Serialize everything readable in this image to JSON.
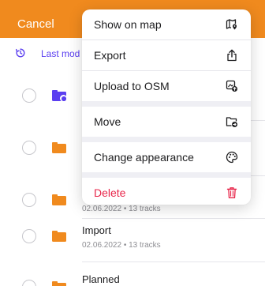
{
  "header": {
    "cancel_label": "Cancel",
    "color": "#f08a1e"
  },
  "sort": {
    "label": "Last mod"
  },
  "list": {
    "items": [
      {
        "title": "",
        "subtitle": "",
        "icon": "folder-settings-icon"
      },
      {
        "title": "",
        "subtitle": "",
        "icon": "folder-icon"
      },
      {
        "title": "",
        "subtitle": "02.06.2022 • 13 tracks",
        "icon": "folder-icon"
      },
      {
        "title": "Import",
        "subtitle": "02.06.2022 • 13 tracks",
        "icon": "folder-icon"
      },
      {
        "title": "Planned",
        "subtitle": "",
        "icon": "folder-icon"
      }
    ]
  },
  "menu": {
    "items": [
      {
        "label": "Show on map",
        "icon": "map-pin-icon"
      },
      {
        "label": "Export",
        "icon": "share-icon"
      },
      {
        "label": "Upload to OSM",
        "icon": "upload-osm-icon"
      },
      {
        "label": "Move",
        "icon": "folder-move-icon"
      },
      {
        "label": "Change appearance",
        "icon": "palette-icon"
      },
      {
        "label": "Delete",
        "icon": "trash-icon"
      }
    ],
    "danger_color": "#e8274b"
  },
  "accent_color": "#5b3ff0"
}
